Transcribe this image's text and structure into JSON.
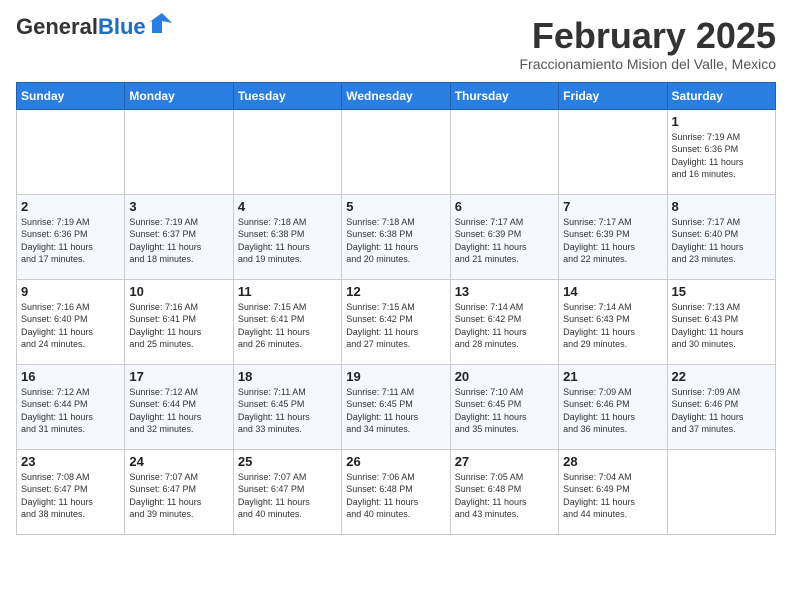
{
  "header": {
    "logo_general": "General",
    "logo_blue": "Blue",
    "month_title": "February 2025",
    "location": "Fraccionamiento Mision del Valle, Mexico"
  },
  "days_of_week": [
    "Sunday",
    "Monday",
    "Tuesday",
    "Wednesday",
    "Thursday",
    "Friday",
    "Saturday"
  ],
  "weeks": [
    [
      {
        "day": "",
        "info": ""
      },
      {
        "day": "",
        "info": ""
      },
      {
        "day": "",
        "info": ""
      },
      {
        "day": "",
        "info": ""
      },
      {
        "day": "",
        "info": ""
      },
      {
        "day": "",
        "info": ""
      },
      {
        "day": "1",
        "info": "Sunrise: 7:19 AM\nSunset: 6:36 PM\nDaylight: 11 hours\nand 16 minutes."
      }
    ],
    [
      {
        "day": "2",
        "info": "Sunrise: 7:19 AM\nSunset: 6:36 PM\nDaylight: 11 hours\nand 17 minutes."
      },
      {
        "day": "3",
        "info": "Sunrise: 7:19 AM\nSunset: 6:37 PM\nDaylight: 11 hours\nand 18 minutes."
      },
      {
        "day": "4",
        "info": "Sunrise: 7:18 AM\nSunset: 6:38 PM\nDaylight: 11 hours\nand 19 minutes."
      },
      {
        "day": "5",
        "info": "Sunrise: 7:18 AM\nSunset: 6:38 PM\nDaylight: 11 hours\nand 20 minutes."
      },
      {
        "day": "6",
        "info": "Sunrise: 7:17 AM\nSunset: 6:39 PM\nDaylight: 11 hours\nand 21 minutes."
      },
      {
        "day": "7",
        "info": "Sunrise: 7:17 AM\nSunset: 6:39 PM\nDaylight: 11 hours\nand 22 minutes."
      },
      {
        "day": "8",
        "info": "Sunrise: 7:17 AM\nSunset: 6:40 PM\nDaylight: 11 hours\nand 23 minutes."
      }
    ],
    [
      {
        "day": "9",
        "info": "Sunrise: 7:16 AM\nSunset: 6:40 PM\nDaylight: 11 hours\nand 24 minutes."
      },
      {
        "day": "10",
        "info": "Sunrise: 7:16 AM\nSunset: 6:41 PM\nDaylight: 11 hours\nand 25 minutes."
      },
      {
        "day": "11",
        "info": "Sunrise: 7:15 AM\nSunset: 6:41 PM\nDaylight: 11 hours\nand 26 minutes."
      },
      {
        "day": "12",
        "info": "Sunrise: 7:15 AM\nSunset: 6:42 PM\nDaylight: 11 hours\nand 27 minutes."
      },
      {
        "day": "13",
        "info": "Sunrise: 7:14 AM\nSunset: 6:42 PM\nDaylight: 11 hours\nand 28 minutes."
      },
      {
        "day": "14",
        "info": "Sunrise: 7:14 AM\nSunset: 6:43 PM\nDaylight: 11 hours\nand 29 minutes."
      },
      {
        "day": "15",
        "info": "Sunrise: 7:13 AM\nSunset: 6:43 PM\nDaylight: 11 hours\nand 30 minutes."
      }
    ],
    [
      {
        "day": "16",
        "info": "Sunrise: 7:12 AM\nSunset: 6:44 PM\nDaylight: 11 hours\nand 31 minutes."
      },
      {
        "day": "17",
        "info": "Sunrise: 7:12 AM\nSunset: 6:44 PM\nDaylight: 11 hours\nand 32 minutes."
      },
      {
        "day": "18",
        "info": "Sunrise: 7:11 AM\nSunset: 6:45 PM\nDaylight: 11 hours\nand 33 minutes."
      },
      {
        "day": "19",
        "info": "Sunrise: 7:11 AM\nSunset: 6:45 PM\nDaylight: 11 hours\nand 34 minutes."
      },
      {
        "day": "20",
        "info": "Sunrise: 7:10 AM\nSunset: 6:45 PM\nDaylight: 11 hours\nand 35 minutes."
      },
      {
        "day": "21",
        "info": "Sunrise: 7:09 AM\nSunset: 6:46 PM\nDaylight: 11 hours\nand 36 minutes."
      },
      {
        "day": "22",
        "info": "Sunrise: 7:09 AM\nSunset: 6:46 PM\nDaylight: 11 hours\nand 37 minutes."
      }
    ],
    [
      {
        "day": "23",
        "info": "Sunrise: 7:08 AM\nSunset: 6:47 PM\nDaylight: 11 hours\nand 38 minutes."
      },
      {
        "day": "24",
        "info": "Sunrise: 7:07 AM\nSunset: 6:47 PM\nDaylight: 11 hours\nand 39 minutes."
      },
      {
        "day": "25",
        "info": "Sunrise: 7:07 AM\nSunset: 6:47 PM\nDaylight: 11 hours\nand 40 minutes."
      },
      {
        "day": "26",
        "info": "Sunrise: 7:06 AM\nSunset: 6:48 PM\nDaylight: 11 hours\nand 40 minutes."
      },
      {
        "day": "27",
        "info": "Sunrise: 7:05 AM\nSunset: 6:48 PM\nDaylight: 11 hours\nand 43 minutes."
      },
      {
        "day": "28",
        "info": "Sunrise: 7:04 AM\nSunset: 6:49 PM\nDaylight: 11 hours\nand 44 minutes."
      },
      {
        "day": "",
        "info": ""
      }
    ]
  ]
}
